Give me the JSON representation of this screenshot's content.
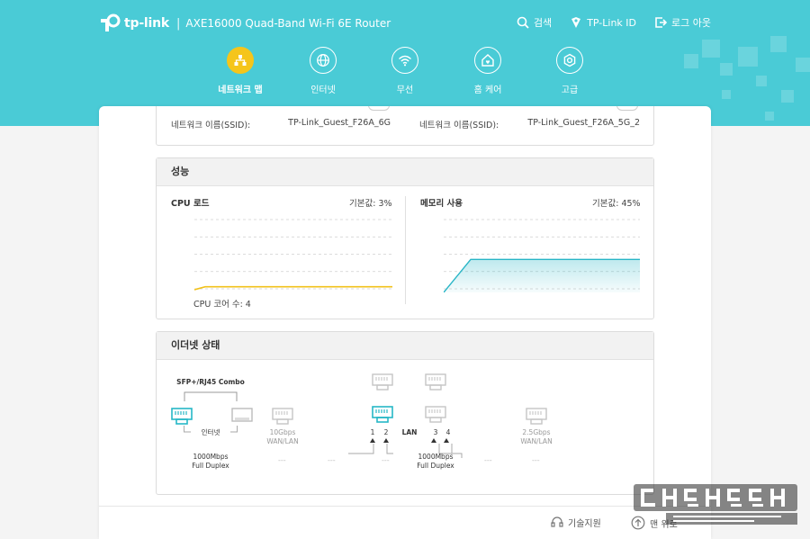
{
  "header": {
    "brand": "tp-link",
    "separator": "|",
    "model": "AXE16000 Quad-Band Wi-Fi 6E Router",
    "links": {
      "search": "검색",
      "id": "TP-Link ID",
      "logout": "로그 아웃"
    }
  },
  "nav": [
    {
      "label": "네트워크 맵",
      "icon": "network-map-icon",
      "active": true
    },
    {
      "label": "인터넷",
      "icon": "globe-icon"
    },
    {
      "label": "무선",
      "icon": "wifi-icon"
    },
    {
      "label": "홈 케어",
      "icon": "home-care-icon"
    },
    {
      "label": "고급",
      "icon": "gear-icon"
    }
  ],
  "guest": {
    "left": {
      "label": "네트워크 이름(SSID):",
      "value": "TP-Link_Guest_F26A_6G"
    },
    "right": {
      "label": "네트워크 이름(SSID):",
      "value": "TP-Link_Guest_F26A_5G_2"
    }
  },
  "performance": {
    "title": "성능",
    "cpu": {
      "label": "CPU 로드",
      "value_text": "기본값: 3%",
      "load_percent": 3,
      "cores_text": "CPU 코어 수: 4"
    },
    "memory": {
      "label": "메모리 사용",
      "value_text": "기본값: 45%",
      "usage_percent": 45
    }
  },
  "ethernet": {
    "title": "이더넷 상태",
    "combo_label": "SFP+/RJ45 Combo",
    "internet_label": "인터넷",
    "internet_speed": "1000Mbps",
    "internet_duplex": "Full Duplex",
    "wan10_line1": "10Gbps",
    "wan10_line2": "WAN/LAN",
    "lan_label": "LAN",
    "lan_ports": [
      "1",
      "2",
      "3",
      "4"
    ],
    "lan_speed": "1000Mbps",
    "lan_duplex": "Full Duplex",
    "wan25_line1": "2.5Gbps",
    "wan25_line2": "WAN/LAN",
    "dash": "---"
  },
  "footer": {
    "support": "기술지원",
    "top": "맨 위로"
  },
  "colors": {
    "header": "#4acbd6",
    "accent": "#26b7c6",
    "active_nav": "#f5c51b",
    "cpu_line": "#f2c21b",
    "mem_line": "#27b5c6"
  }
}
